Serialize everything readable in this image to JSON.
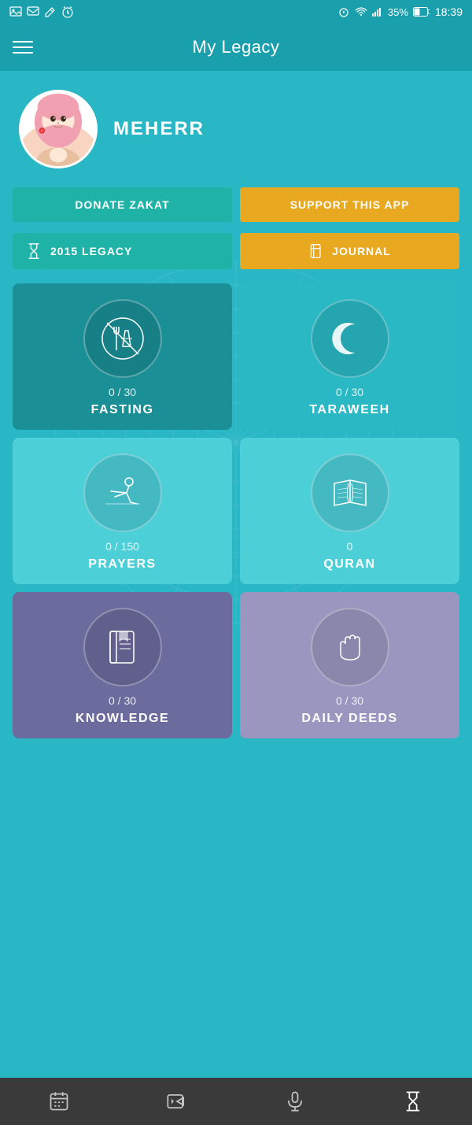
{
  "statusBar": {
    "time": "18:39",
    "battery": "35%",
    "leftIcons": [
      "image-icon",
      "message-icon",
      "edit-icon",
      "alarm-icon"
    ]
  },
  "header": {
    "title": "My Legacy",
    "menuLabel": "menu"
  },
  "profile": {
    "username": "MEHERR"
  },
  "buttons": {
    "donateZakat": "DONATE ZAKAT",
    "supportApp": "SUPPORT THIS APP",
    "legacy": "2015 LEGACY",
    "journal": "JOURNAL"
  },
  "cards": [
    {
      "id": "fasting",
      "label": "FASTING",
      "count": "0 / 30",
      "colorClass": "card-dark-teal"
    },
    {
      "id": "taraweeh",
      "label": "TARAWEEH",
      "count": "0 / 30",
      "colorClass": "card-medium-teal"
    },
    {
      "id": "prayers",
      "label": "PRAYERS",
      "count": "0 / 150",
      "colorClass": "card-light-teal"
    },
    {
      "id": "quran",
      "label": "QURAN",
      "count": "0",
      "colorClass": "card-light-teal"
    },
    {
      "id": "knowledge",
      "label": "KNOWLEDGE",
      "count": "0 / 30",
      "colorClass": "card-purple"
    },
    {
      "id": "daily-deeds",
      "label": "DAILY DEEDS",
      "count": "0 / 30",
      "colorClass": "card-light-purple"
    }
  ],
  "bottomNav": [
    {
      "id": "calendar",
      "label": "Calendar"
    },
    {
      "id": "video",
      "label": "Video"
    },
    {
      "id": "microphone",
      "label": "Microphone"
    },
    {
      "id": "legacy-timer",
      "label": "Legacy Timer"
    }
  ]
}
